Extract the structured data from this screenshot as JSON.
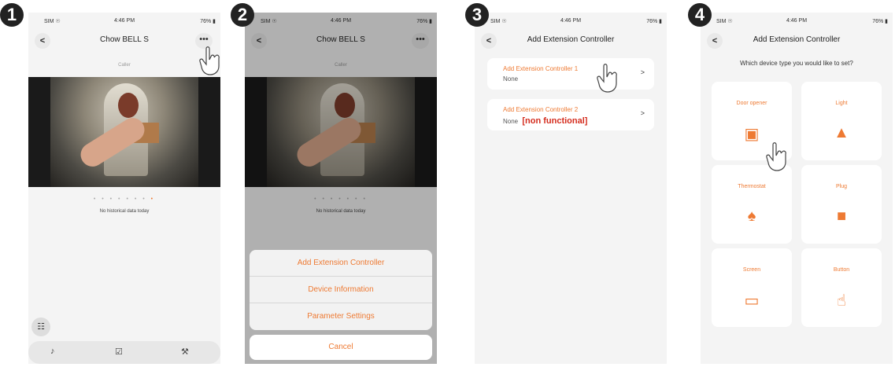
{
  "status_bar": {
    "carrier": "SIM ☉",
    "time": "4:46 PM",
    "battery": "76% ▮"
  },
  "steps": [
    "1",
    "2",
    "3",
    "4"
  ],
  "screen1": {
    "title": "Chow BELL S",
    "more_label": "•••",
    "subtitle": "Caller",
    "dots": "• • • • • • •",
    "dot_active": "•",
    "no_history": "No historical data today",
    "calendar_icon": "☷",
    "bottom_icons": [
      "♪",
      "☑",
      "⚒"
    ]
  },
  "screen2": {
    "title": "Chow BELL S",
    "more_label": "•••",
    "subtitle": "Caller",
    "no_history": "No historical data today",
    "menu": [
      "Add Extension Controller",
      "Device Information",
      "Parameter Settings"
    ],
    "cancel": "Cancel"
  },
  "screen3": {
    "title": "Add Extension Controller",
    "cards": [
      {
        "title": "Add Extension Controller 1",
        "value": "None",
        "note": ""
      },
      {
        "title": "Add Extension Controller 2",
        "value": "None",
        "note": "[non functional]"
      }
    ]
  },
  "screen4": {
    "title": "Add Extension Controller",
    "question": "Which device type you would like to set?",
    "devices": [
      {
        "label": "Door opener",
        "icon": "▣"
      },
      {
        "label": "Light",
        "icon": "▲"
      },
      {
        "label": "Thermostat",
        "icon": "♠"
      },
      {
        "label": "Plug",
        "icon": "■"
      },
      {
        "label": "Screen",
        "icon": "▭"
      },
      {
        "label": "Button",
        "icon": "☝"
      }
    ]
  },
  "colors": {
    "accent": "#ee7a33",
    "warning": "#d42c1d"
  }
}
